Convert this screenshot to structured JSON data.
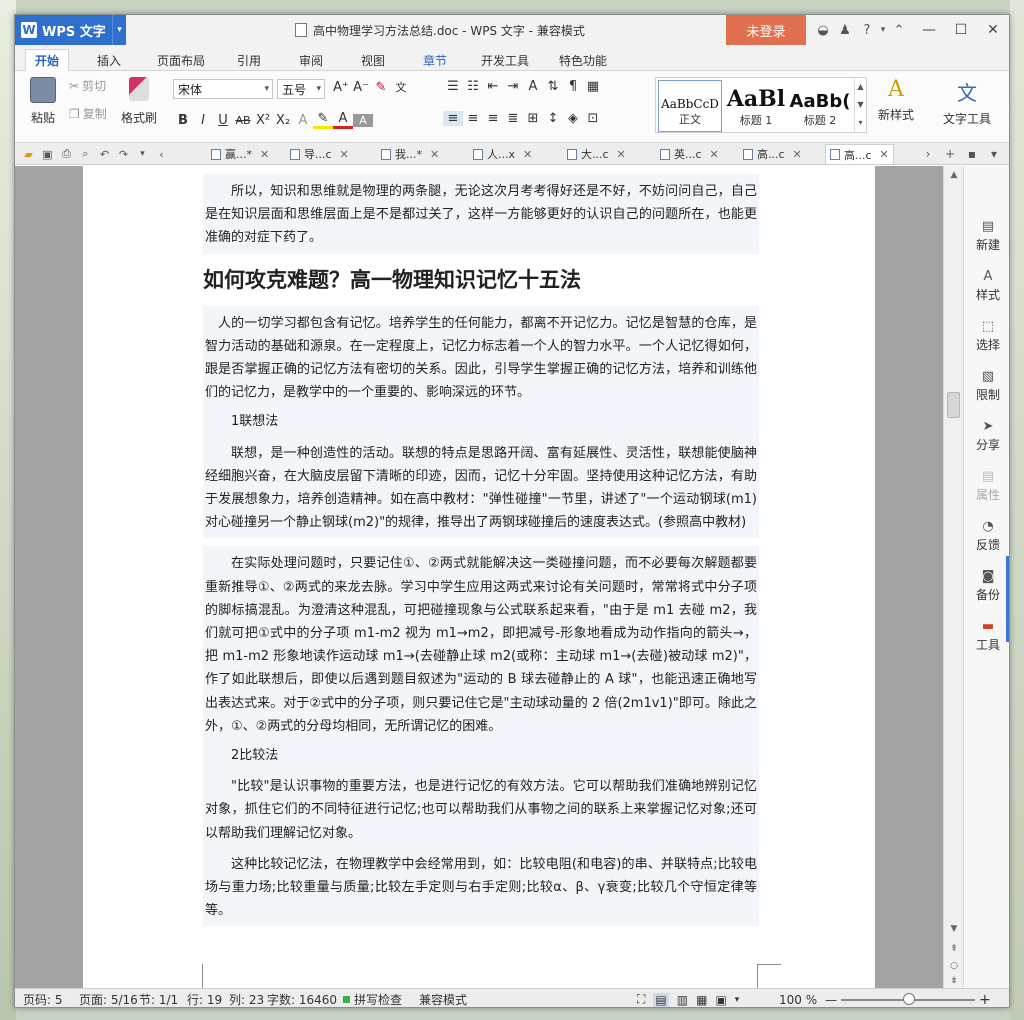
{
  "window": {
    "app_name": "WPS 文字",
    "title": "高中物理学习方法总结.doc - WPS 文字 - 兼容模式",
    "login_label": "未登录"
  },
  "menu": {
    "tabs": [
      "开始",
      "插入",
      "页面布局",
      "引用",
      "审阅",
      "视图",
      "章节",
      "开发工具",
      "特色功能"
    ],
    "active_index": 0
  },
  "ribbon": {
    "paste": "粘贴",
    "cut": "剪切",
    "copy": "复制",
    "format_painter": "格式刷",
    "font_name": "宋体",
    "font_size": "五号",
    "styles": [
      {
        "sample": "AaBbCcD",
        "label": "正文"
      },
      {
        "sample": "AaBl",
        "label": "标题 1"
      },
      {
        "sample": "AaBb(",
        "label": "标题 2"
      }
    ],
    "new_style": "新样式",
    "text_tools": "文字工具"
  },
  "doc_tabs": [
    "赢...*",
    "导...c",
    "我...*",
    "人...x",
    "大...c",
    "英...c",
    "高...c",
    "高...c"
  ],
  "document": {
    "para_intro": "所以，知识和思维就是物理的两条腿，无论这次月考考得好还是不好，不妨问问自己，自己是在知识层面和思维层面上是不是都过关了，这样一方能够更好的认识自己的问题所在，也能更准确的对症下药了。",
    "heading": "如何攻克难题？高一物理知识记忆十五法",
    "para_memory": "人的一切学习都包含有记忆。培养学生的任何能力，都离不开记忆力。记忆是智慧的仓库，是智力活动的基础和源泉。在一定程度上，记忆力标志着一个人的智力水平。一个人记忆得如何，跟是否掌握正确的记忆方法有密切的关系。因此，引导学生掌握正确的记忆方法，培养和训练他们的记忆力，是教学中的一个重要的、影响深远的环节。",
    "sub1": "1联想法",
    "para_assoc1": "联想，是一种创造性的活动。联想的特点是思路开阔、富有延展性、灵活性，联想能使脑神经细胞兴奋，在大脑皮层留下清晰的印迹，因而，记忆十分牢固。坚持使用这种记忆方法，有助于发展想象力，培养创造精神。如在高中教材：\"弹性碰撞\"一节里，讲述了\"一个运动钢球(m1)对心碰撞另一个静止钢球(m2)\"的规律，推导出了两钢球碰撞后的速度表达式。(参照高中教材)",
    "para_assoc2": "在实际处理问题时，只要记住①、②两式就能解决这一类碰撞问题，而不必要每次解题都要重新推导①、②两式的来龙去脉。学习中学生应用这两式来讨论有关问题时，常常将式中分子项的脚标搞混乱。为澄清这种混乱，可把碰撞现象与公式联系起来看，\"由于是 m1 去碰 m2，我们就可把①式中的分子项 m1-m2 视为 m1→m2，即把减号-形象地看成为动作指向的箭头→，把 m1-m2 形象地读作运动球 m1→(去碰静止球 m2(或称：主动球 m1→(去碰)被动球 m2)\"，作了如此联想后，即使以后遇到题目叙述为\"运动的 B 球去碰静止的 A 球\"，也能迅速正确地写出表达式来。对于②式中的分子项，则只要记住它是\"主动球动量的 2 倍(2m1v1)\"即可。除此之外，①、②两式的分母均相同，无所谓记忆的困难。",
    "sub2": "2比较法",
    "para_compare1": "\"比较\"是认识事物的重要方法，也是进行记忆的有效方法。它可以帮助我们准确地辨别记忆对象，抓住它们的不同特征进行记忆;也可以帮助我们从事物之间的联系上来掌握记忆对象;还可以帮助我们理解记忆对象。",
    "para_compare2": "这种比较记忆法，在物理教学中会经常用到，如：比较电阻(和电容)的串、并联特点;比较电场与重力场;比较重量与质量;比较左手定则与右手定则;比较α、β、γ衰变;比较几个守恒定律等等。"
  },
  "taskpane": {
    "items": [
      "新建",
      "样式",
      "选择",
      "限制",
      "分享",
      "属性",
      "反馈",
      "备份",
      "工具"
    ]
  },
  "status": {
    "page_num": "页码: 5",
    "pages": "页面: 5/16",
    "section": "节: 1/1",
    "row": "行: 19",
    "col": "列: 23",
    "words": "字数: 16460",
    "spell": "拼写检查",
    "mode": "兼容模式",
    "zoom": "100 %"
  },
  "colors": {
    "app_blue": "#2f6fce",
    "login_orange": "#e07050",
    "active_tab_text": "#2a64c0"
  }
}
